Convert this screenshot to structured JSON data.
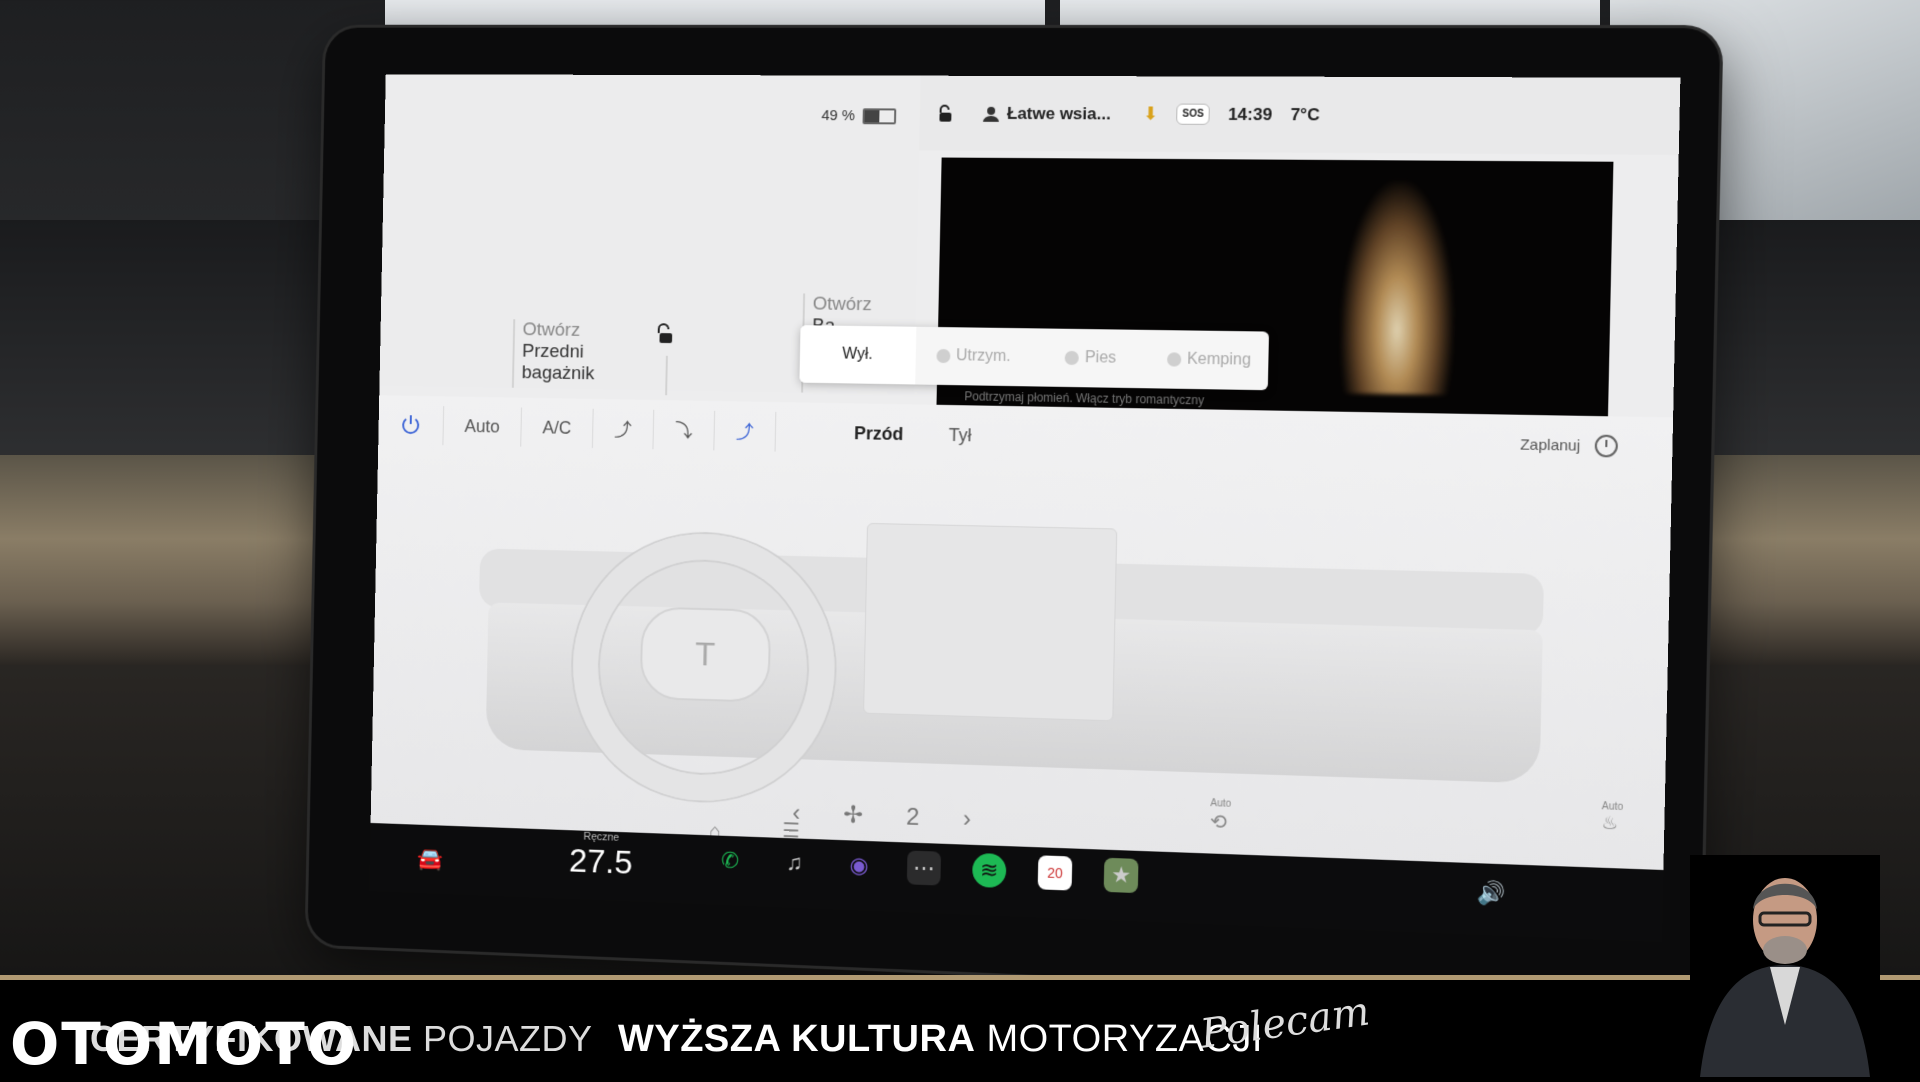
{
  "status": {
    "battery_percent": "49 %",
    "battery_level": 0.49,
    "profile_name": "Łatwe wsia...",
    "sos": "SOS",
    "time": "14:39",
    "temperature": "7°C"
  },
  "trunk": {
    "front_action": "Otwórz",
    "front_line1": "Przedni",
    "front_line2": "bagażnik",
    "rear_action": "Otwórz",
    "rear_label": "Ba"
  },
  "camp_popup": {
    "options": [
      "Wył.",
      "Utrzym.",
      "Pies",
      "Kemping"
    ],
    "selected": "Wył."
  },
  "video": {
    "caption": "Podtrzymaj płomień. Włącz tryb romantyczny"
  },
  "climate": {
    "buttons": [
      "Auto",
      "A/C"
    ],
    "zone_front": "Przód",
    "zone_rear": "Tył",
    "schedule_label": "Zaplanuj",
    "fan_speed": "2",
    "recirc_label": "Auto",
    "seat_label": "Auto"
  },
  "dock": {
    "temp_label": "Ręczne",
    "temp_value": "27.5",
    "calendar_day": "20"
  },
  "watermark": {
    "logo": "OTOMOTO",
    "tag1_bold": "CERTYFIKOWANE",
    "tag1_rest": " POJAZDY",
    "tag2_bold": "WYŻSZA KULTURA",
    "tag2_rest": " MOTORYZACJI",
    "signature": "Polecam"
  },
  "colors": {
    "accent_blue": "#3b63d6",
    "banner_gold": "#b19a73",
    "spotify_green": "#1db954"
  }
}
